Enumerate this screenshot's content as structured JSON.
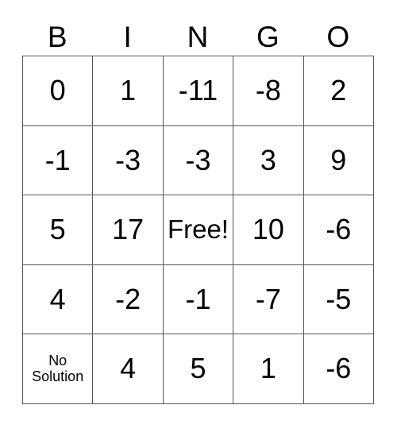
{
  "card": {
    "type": "bingo-card",
    "headers": [
      "B",
      "I",
      "N",
      "G",
      "O"
    ],
    "rows": [
      [
        "0",
        "1",
        "-11",
        "-8",
        "2"
      ],
      [
        "-1",
        "-3",
        "-3",
        "3",
        "9"
      ],
      [
        "5",
        "17",
        "Free!",
        "10",
        "-6"
      ],
      [
        "4",
        "-2",
        "-1",
        "-7",
        "-5"
      ],
      [
        "No Solution",
        "4",
        "5",
        "1",
        "-6"
      ]
    ],
    "free_space": {
      "row": 2,
      "col": 2,
      "label": "Free!"
    },
    "colors": {
      "background": "#ffffff",
      "text": "#000000",
      "grid_line": "#555555"
    }
  }
}
